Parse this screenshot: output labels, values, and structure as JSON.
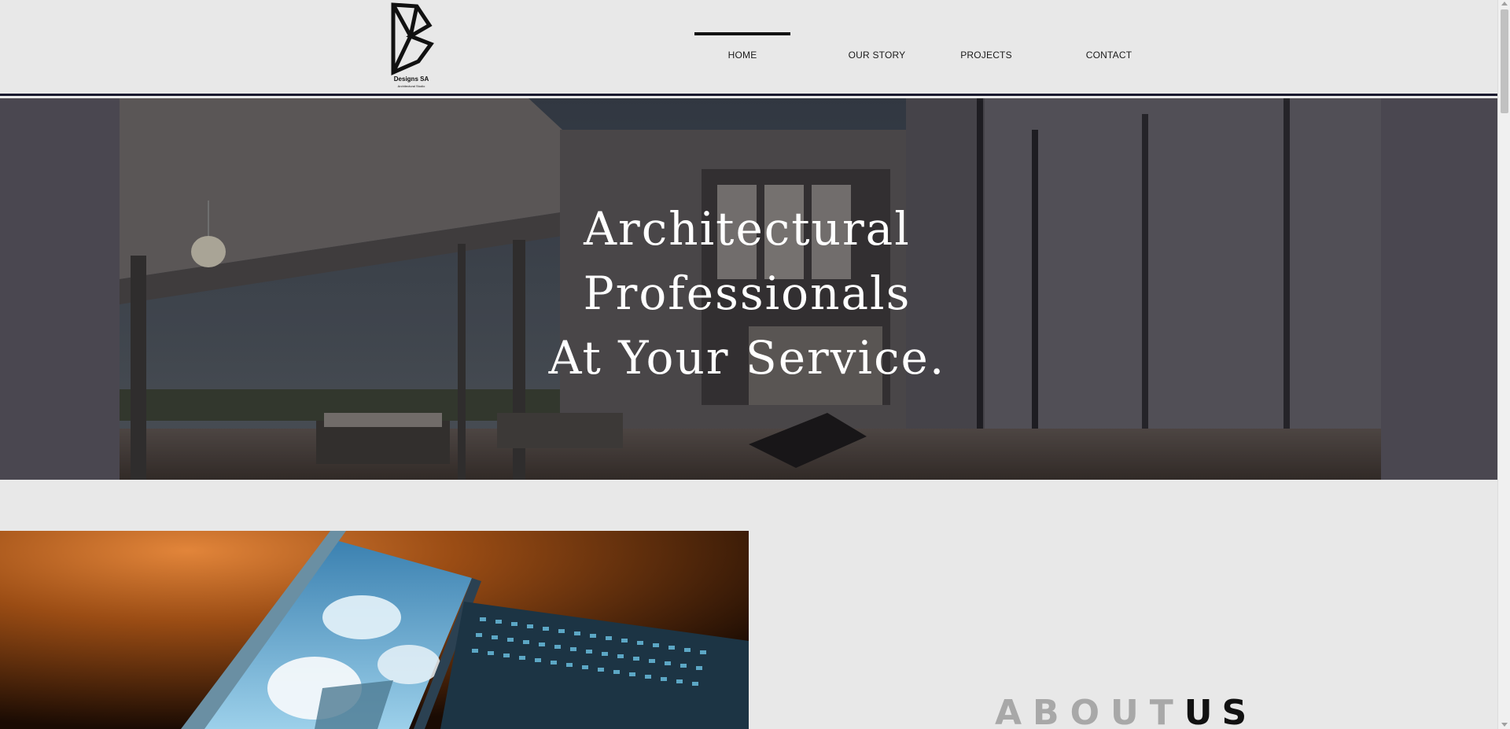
{
  "logo": {
    "name": "Designs SA",
    "tagline": "Architectural Studio"
  },
  "nav": {
    "items": [
      {
        "label": "HOME",
        "active": true
      },
      {
        "label": "OUR STORY",
        "active": false
      },
      {
        "label": "PROJECTS",
        "active": false
      },
      {
        "label": "CONTACT",
        "active": false
      }
    ]
  },
  "hero": {
    "line1": "Architectural",
    "line2": "Professionals",
    "line3": "At Your Service."
  },
  "about": {
    "word1": "ABOUT",
    "word2": "US"
  },
  "colors": {
    "background": "#e8e8e8",
    "header_border": "#1a1a2e",
    "hero_text": "#ffffff",
    "about_light": "#a8a8a8",
    "about_dark": "#111111"
  }
}
